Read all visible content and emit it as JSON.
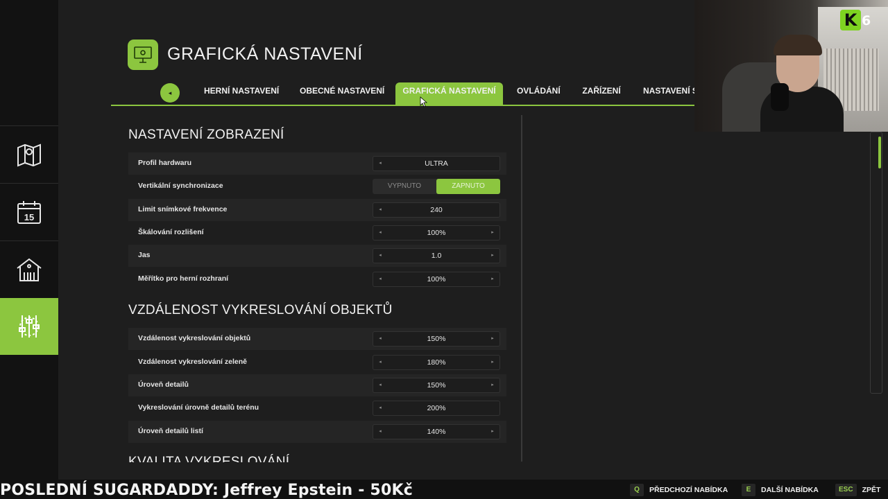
{
  "header": {
    "title": "GRAFICKÁ NASTAVENÍ"
  },
  "tabs": [
    {
      "label": "HERNÍ NASTAVENÍ",
      "active": false
    },
    {
      "label": "OBECNÉ NASTAVENÍ",
      "active": false
    },
    {
      "label": "GRAFICKÁ NASTAVENÍ",
      "active": true
    },
    {
      "label": "OVLÁDÁNÍ",
      "active": false
    },
    {
      "label": "ZAŘÍZENÍ",
      "active": false
    },
    {
      "label": "NASTAVENÍ S",
      "active": false
    }
  ],
  "sidebar": {
    "items": [
      {
        "icon": "map-icon",
        "active": false
      },
      {
        "icon": "calendar-icon",
        "calendar_day": "15",
        "active": false
      },
      {
        "icon": "barn-icon",
        "active": false
      },
      {
        "icon": "settings-sliders-icon",
        "active": true
      }
    ]
  },
  "sections": [
    {
      "title": "NASTAVENÍ ZOBRAZENÍ",
      "rows": [
        {
          "label": "Profil hardwaru",
          "value": "ULTRA",
          "type": "stepper",
          "left_arrow": "◂",
          "right_arrow": ""
        },
        {
          "label": "Vertikální synchronizace",
          "type": "toggle",
          "off": "VYPNUTO",
          "on": "ZAPNUTO"
        },
        {
          "label": "Limit snímkové frekvence",
          "value": "240",
          "type": "stepper",
          "left_arrow": "◂",
          "right_arrow": ""
        },
        {
          "label": "Škálování rozlišení",
          "value": "100%",
          "type": "stepper",
          "left_arrow": "◂",
          "right_arrow": "▸"
        },
        {
          "label": "Jas",
          "value": "1.0",
          "type": "stepper",
          "left_arrow": "◂",
          "right_arrow": "▸"
        },
        {
          "label": "Měřítko pro herní rozhraní",
          "value": "100%",
          "type": "stepper",
          "left_arrow": "◂",
          "right_arrow": "▸"
        }
      ]
    },
    {
      "title": "VZDÁLENOST VYKRESLOVÁNÍ OBJEKTŮ",
      "rows": [
        {
          "label": "Vzdálenost vykreslování objektů",
          "value": "150%",
          "type": "stepper",
          "left_arrow": "◂",
          "right_arrow": "▸"
        },
        {
          "label": "Vzdálenost vykreslování zeleně",
          "value": "180%",
          "type": "stepper",
          "left_arrow": "◂",
          "right_arrow": "▸"
        },
        {
          "label": "Úroveň detailů",
          "value": "150%",
          "type": "stepper",
          "left_arrow": "◂",
          "right_arrow": "▸"
        },
        {
          "label": "Vykreslování úrovně detailů terénu",
          "value": "200%",
          "type": "stepper",
          "left_arrow": "◂",
          "right_arrow": ""
        },
        {
          "label": "Úroveň detailů listí",
          "value": "140%",
          "type": "stepper",
          "left_arrow": "◂",
          "right_arrow": "▸"
        }
      ]
    },
    {
      "title": "KVALITA VYKRESLOVÁNÍ",
      "rows": []
    }
  ],
  "tab_prev": "◂",
  "stream": {
    "ticker": "POSLEDNÍ SUGARDADDY: Jeffrey Epstein - 50Kč",
    "logo_letter": "K",
    "logo_number": "6"
  },
  "footer": {
    "hints": [
      {
        "key": "Q",
        "label": "PŘEDCHOZÍ NABÍDKA"
      },
      {
        "key": "E",
        "label": "DALŠÍ NABÍDKA"
      },
      {
        "key": "ESC",
        "label": "ZPĚT"
      }
    ]
  },
  "colors": {
    "accent": "#8cc63f",
    "background": "#1e1e1e",
    "sidebar": "#121212"
  }
}
